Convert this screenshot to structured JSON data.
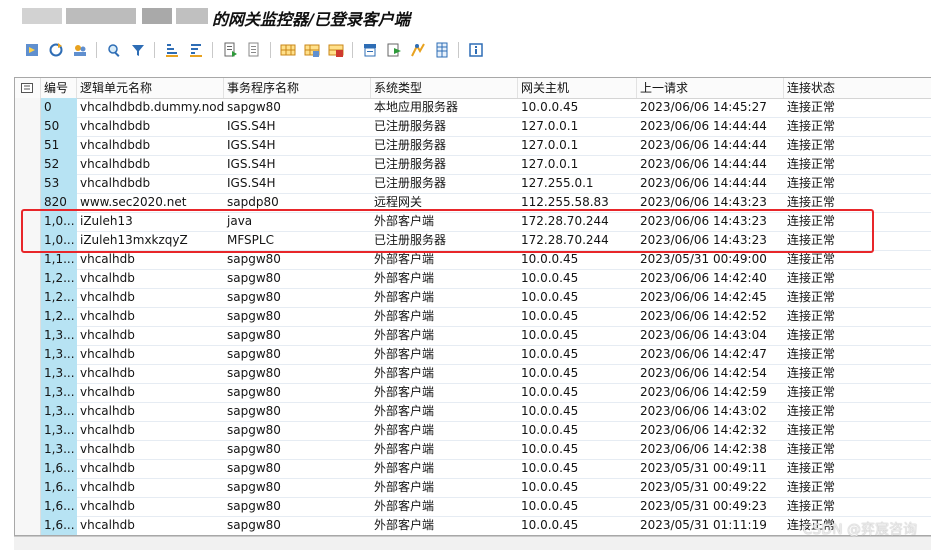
{
  "window": {
    "title": "的网关监控器/已登录客户端"
  },
  "toolbar": {
    "buttons": [
      {
        "name": "refresh-icon"
      },
      {
        "name": "reload-icon"
      },
      {
        "name": "users-icon"
      },
      {
        "name": "find-icon"
      },
      {
        "name": "filter-icon"
      },
      {
        "name": "sort-ascending-icon"
      },
      {
        "name": "sort-descending-icon"
      },
      {
        "name": "export-icon"
      },
      {
        "name": "details-icon"
      },
      {
        "name": "layout-icon"
      },
      {
        "name": "choose-layout-icon"
      },
      {
        "name": "save-layout-icon"
      },
      {
        "name": "print-icon"
      },
      {
        "name": "download-icon"
      },
      {
        "name": "graphic-icon"
      },
      {
        "name": "spreadsheet-icon"
      },
      {
        "name": "info-icon"
      }
    ]
  },
  "table": {
    "columns": [
      "编号",
      "逻辑单元名称",
      "事务程序名称",
      "系统类型",
      "网关主机",
      "上一请求",
      "连接状态"
    ],
    "rows": [
      [
        "0",
        "vhcalhdbdb.dummy.nod...",
        "sapgw80",
        "本地应用服务器",
        "10.0.0.45",
        "2023/06/06 14:45:27",
        "连接正常"
      ],
      [
        "50",
        "vhcalhdbdb",
        "IGS.S4H",
        "已注册服务器",
        "127.0.0.1",
        "2023/06/06 14:44:44",
        "连接正常"
      ],
      [
        "51",
        "vhcalhdbdb",
        "IGS.S4H",
        "已注册服务器",
        "127.0.0.1",
        "2023/06/06 14:44:44",
        "连接正常"
      ],
      [
        "52",
        "vhcalhdbdb",
        "IGS.S4H",
        "已注册服务器",
        "127.0.0.1",
        "2023/06/06 14:44:44",
        "连接正常"
      ],
      [
        "53",
        "vhcalhdbdb",
        "IGS.S4H",
        "已注册服务器",
        "127.255.0.1",
        "2023/06/06 14:44:44",
        "连接正常"
      ],
      [
        "820",
        "www.sec2020.net",
        "sapdp80",
        "远程网关",
        "112.255.58.83",
        "2023/06/06 14:43:23",
        "连接正常"
      ],
      [
        "1,0...",
        "iZuleh13",
        "java",
        "外部客户端",
        "172.28.70.244",
        "2023/06/06 14:43:23",
        "连接正常"
      ],
      [
        "1,0...",
        "iZuleh13mxkzqyZ",
        "MFSPLC",
        "已注册服务器",
        "172.28.70.244",
        "2023/06/06 14:43:23",
        "连接正常"
      ],
      [
        "1,1...",
        "vhcalhdb",
        "sapgw80",
        "外部客户端",
        "10.0.0.45",
        "2023/05/31 00:49:00",
        "连接正常"
      ],
      [
        "1,2...",
        "vhcalhdb",
        "sapgw80",
        "外部客户端",
        "10.0.0.45",
        "2023/06/06 14:42:40",
        "连接正常"
      ],
      [
        "1,2...",
        "vhcalhdb",
        "sapgw80",
        "外部客户端",
        "10.0.0.45",
        "2023/06/06 14:42:45",
        "连接正常"
      ],
      [
        "1,2...",
        "vhcalhdb",
        "sapgw80",
        "外部客户端",
        "10.0.0.45",
        "2023/06/06 14:42:52",
        "连接正常"
      ],
      [
        "1,3...",
        "vhcalhdb",
        "sapgw80",
        "外部客户端",
        "10.0.0.45",
        "2023/06/06 14:43:04",
        "连接正常"
      ],
      [
        "1,3...",
        "vhcalhdb",
        "sapgw80",
        "外部客户端",
        "10.0.0.45",
        "2023/06/06 14:42:47",
        "连接正常"
      ],
      [
        "1,3...",
        "vhcalhdb",
        "sapgw80",
        "外部客户端",
        "10.0.0.45",
        "2023/06/06 14:42:54",
        "连接正常"
      ],
      [
        "1,3...",
        "vhcalhdb",
        "sapgw80",
        "外部客户端",
        "10.0.0.45",
        "2023/06/06 14:42:59",
        "连接正常"
      ],
      [
        "1,3...",
        "vhcalhdb",
        "sapgw80",
        "外部客户端",
        "10.0.0.45",
        "2023/06/06 14:43:02",
        "连接正常"
      ],
      [
        "1,3...",
        "vhcalhdb",
        "sapgw80",
        "外部客户端",
        "10.0.0.45",
        "2023/06/06 14:42:32",
        "连接正常"
      ],
      [
        "1,3...",
        "vhcalhdb",
        "sapgw80",
        "外部客户端",
        "10.0.0.45",
        "2023/06/06 14:42:38",
        "连接正常"
      ],
      [
        "1,6...",
        "vhcalhdb",
        "sapgw80",
        "外部客户端",
        "10.0.0.45",
        "2023/05/31 00:49:11",
        "连接正常"
      ],
      [
        "1,6...",
        "vhcalhdb",
        "sapgw80",
        "外部客户端",
        "10.0.0.45",
        "2023/05/31 00:49:22",
        "连接正常"
      ],
      [
        "1,6...",
        "vhcalhdb",
        "sapgw80",
        "外部客户端",
        "10.0.0.45",
        "2023/05/31 00:49:23",
        "连接正常"
      ],
      [
        "1,6...",
        "vhcalhdb",
        "sapgw80",
        "外部客户端",
        "10.0.0.45",
        "2023/05/31 01:11:19",
        "连接正常"
      ]
    ]
  },
  "watermark": "CSDN @弈宸咨询",
  "colors": {
    "number_column_bg": "#b7e3f3",
    "highlight_border": "#e8262a"
  }
}
